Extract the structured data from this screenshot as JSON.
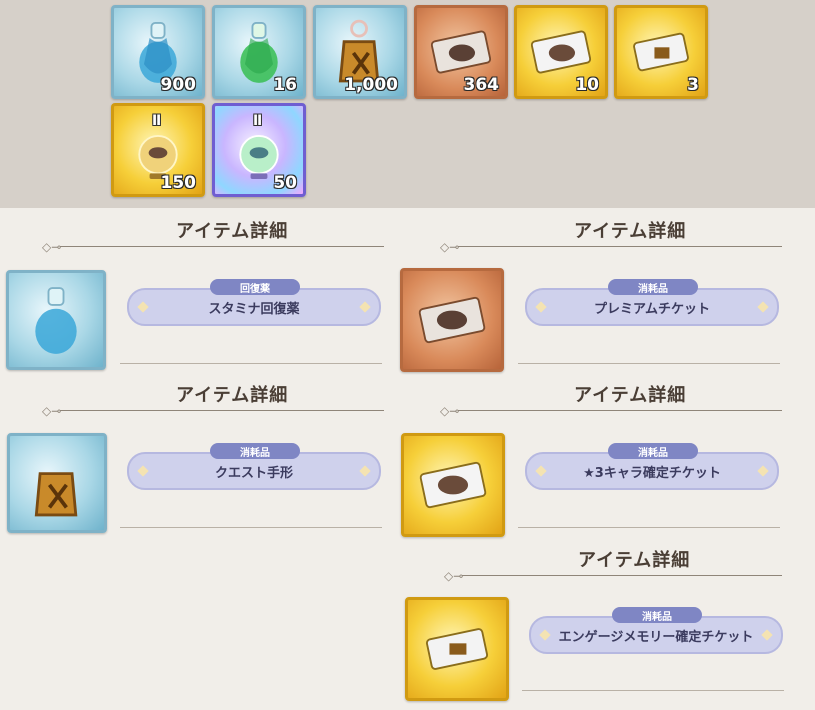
{
  "inventory": [
    {
      "name": "stamina-potion",
      "count": "900"
    },
    {
      "name": "green-potion",
      "count": "16"
    },
    {
      "name": "quest-pass",
      "count": "1,000"
    },
    {
      "name": "premium-ticket",
      "count": "364"
    },
    {
      "name": "gold-ticket",
      "count": "10"
    },
    {
      "name": "gold-ticket-2",
      "count": "3"
    },
    {
      "name": "gold-orb-ii",
      "count": "150",
      "roman": "Ⅱ"
    },
    {
      "name": "rainbow-orb-ii",
      "count": "50",
      "roman": "Ⅱ"
    }
  ],
  "details": [
    {
      "title": "アイテム詳細",
      "category": "回復薬",
      "name": "スタミナ回復薬"
    },
    {
      "title": "アイテム詳細",
      "category": "消耗品",
      "name": "プレミアムチケット"
    },
    {
      "title": "アイテム詳細",
      "category": "消耗品",
      "name": "クエスト手形"
    },
    {
      "title": "アイテム詳細",
      "category": "消耗品",
      "name": "★3キャラ確定チケット"
    },
    {
      "title": "アイテム詳細",
      "category": "消耗品",
      "name": "エンゲージメモリー確定チケット"
    }
  ],
  "colors": {
    "accent": "#7f86c4",
    "plate": "#cfd1ec",
    "gold": "#f6cf39",
    "copper": "#d98a5a",
    "blue": "#a9d7e6"
  }
}
